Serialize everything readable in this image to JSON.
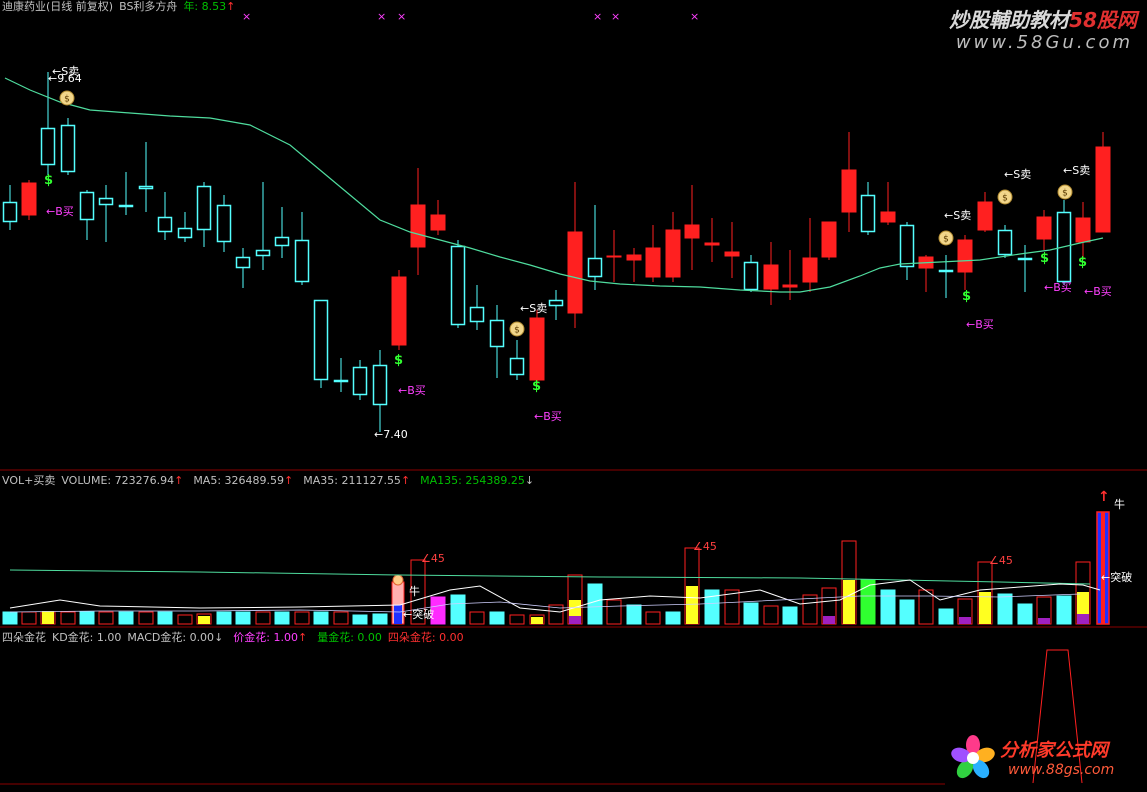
{
  "main_panel": {
    "header": [
      {
        "text": "迪康药业(日线 前复权)",
        "color": "#c0c0c0"
      },
      {
        "text": "BS利多方舟",
        "color": "#c0c0c0"
      },
      {
        "text": "年: 8.53",
        "color": "#00c000"
      },
      {
        "text": "↑",
        "color": "#ff3030"
      }
    ],
    "price_high_label": "←9.64",
    "price_low_label": "←7.40",
    "sell_label": "←S卖",
    "buy_label": "←B买",
    "dollar_label": "$"
  },
  "volume_panel": {
    "header": [
      {
        "text": "VOL+买卖",
        "color": "#c0c0c0"
      },
      {
        "text": "VOLUME: 723276.94",
        "color": "#c0c0c0"
      },
      {
        "text": "↑",
        "color": "#ff3030"
      },
      {
        "text": "MA5: 326489.59",
        "color": "#c0c0c0"
      },
      {
        "text": "↑",
        "color": "#ff3030"
      },
      {
        "text": "MA35: 211127.55",
        "color": "#c0c0c0"
      },
      {
        "text": "↑",
        "color": "#ff3030"
      },
      {
        "text": "MA135: 254389.25",
        "color": "#00c000"
      },
      {
        "text": "↓",
        "color": "#c0c0c0"
      }
    ],
    "angle_label": "∠45",
    "niu_label": "牛",
    "break_label": "←突破",
    "bull_label": "牛",
    "arrow_label": "↑"
  },
  "indicator_panel": {
    "header": [
      {
        "text": "四朵金花",
        "color": "#c0c0c0"
      },
      {
        "text": "KD金花: 1.00",
        "color": "#c0c0c0"
      },
      {
        "text": "MACD金花: 0.00",
        "color": "#c0c0c0"
      },
      {
        "text": "↓",
        "color": "#c0c0c0"
      },
      {
        "text": "价金花: 1.00",
        "color": "#ff40ff"
      },
      {
        "text": "↑",
        "color": "#ff3030"
      },
      {
        "text": "量金花: 0.00",
        "color": "#00c000"
      },
      {
        "text": "四朵金花: 0.00",
        "color": "#ff3030"
      }
    ]
  },
  "watermarks": {
    "top_title": "炒股輔助教材",
    "top_brand": "58股网",
    "top_url": "www.58Gu.com",
    "bottom_title": "分析家公式网",
    "bottom_url": "www.88gs.com"
  },
  "colors": {
    "up": "#ff2020",
    "down": "#54ffff",
    "ma": "#4fdc9e",
    "grid": "#8a0000",
    "yellow": "#ffff20",
    "magenta": "#ff2aff",
    "purple": "#a020c0",
    "green": "#30ff30"
  }
}
